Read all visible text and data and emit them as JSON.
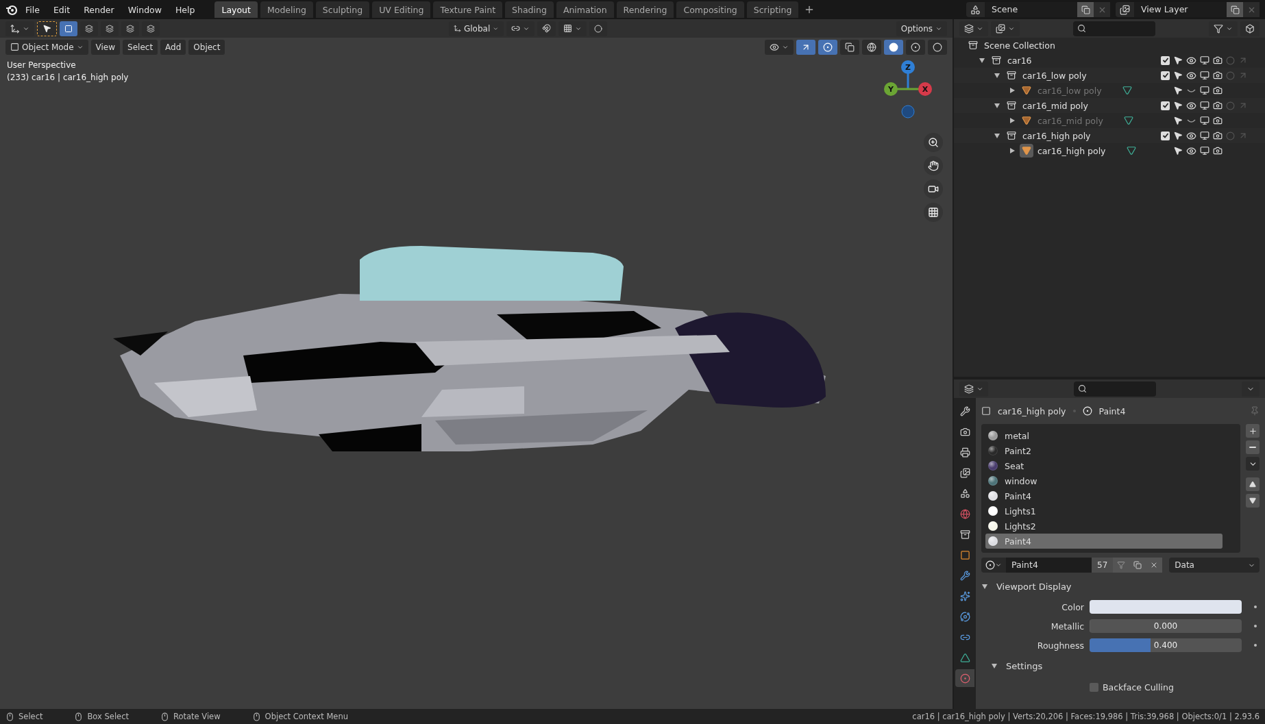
{
  "menu": [
    "File",
    "Edit",
    "Render",
    "Window",
    "Help"
  ],
  "workspaces": [
    {
      "label": "Layout",
      "selected": true
    },
    {
      "label": "Modeling",
      "selected": false
    },
    {
      "label": "Sculpting",
      "selected": false
    },
    {
      "label": "UV Editing",
      "selected": false
    },
    {
      "label": "Texture Paint",
      "selected": false
    },
    {
      "label": "Shading",
      "selected": false
    },
    {
      "label": "Animation",
      "selected": false
    },
    {
      "label": "Rendering",
      "selected": false
    },
    {
      "label": "Compositing",
      "selected": false
    },
    {
      "label": "Scripting",
      "selected": false
    }
  ],
  "scene": {
    "name": "Scene"
  },
  "view_layer": {
    "name": "View Layer"
  },
  "tool_header": {
    "orientation": "Global",
    "options": "Options"
  },
  "viewport_header": {
    "mode": "Object Mode",
    "menus": [
      "View",
      "Select",
      "Add",
      "Object"
    ]
  },
  "viewport": {
    "overlay_lines": [
      "User Perspective",
      "(233) car16 | car16_high poly"
    ],
    "gizmo_axes": [
      {
        "label": "Z",
        "color": "#2f7fd6"
      },
      {
        "label": "Y",
        "color": "#6ba534"
      },
      {
        "label": "X",
        "color": "#d63a4a"
      }
    ],
    "car": {
      "kind": "picture"
    }
  },
  "outliner": {
    "root": "Scene Collection",
    "items": [
      {
        "name": "car16",
        "kind": "collection",
        "expanded": true,
        "checked": true,
        "visible": true,
        "selected": false,
        "children": [
          {
            "name": "car16_low poly",
            "kind": "collection",
            "expanded": true,
            "checked": true,
            "visible": true,
            "selected": false,
            "children": [
              {
                "name": "car16_low poly",
                "kind": "mesh",
                "expanded": false,
                "visible": false,
                "selected": false
              }
            ]
          },
          {
            "name": "car16_mid poly",
            "kind": "collection",
            "expanded": true,
            "checked": true,
            "visible": true,
            "selected": false,
            "children": [
              {
                "name": "car16_mid poly",
                "kind": "mesh",
                "expanded": false,
                "visible": false,
                "selected": false
              }
            ]
          },
          {
            "name": "car16_high poly",
            "kind": "collection",
            "expanded": true,
            "checked": true,
            "visible": true,
            "selected": false,
            "children": [
              {
                "name": "car16_high poly",
                "kind": "mesh",
                "expanded": false,
                "visible": true,
                "selected": true
              }
            ]
          }
        ]
      }
    ]
  },
  "properties": {
    "tabs": [
      {
        "kind": "tool",
        "selected": false
      },
      {
        "kind": "render",
        "selected": false
      },
      {
        "kind": "output",
        "selected": false
      },
      {
        "kind": "view_layer",
        "selected": false
      },
      {
        "kind": "scene",
        "selected": false
      },
      {
        "kind": "world",
        "selected": false
      },
      {
        "kind": "collection",
        "selected": false
      },
      {
        "kind": "object",
        "selected": false
      },
      {
        "kind": "modifiers",
        "selected": false
      },
      {
        "kind": "particles",
        "selected": false
      },
      {
        "kind": "physics",
        "selected": false
      },
      {
        "kind": "constraints",
        "selected": false
      },
      {
        "kind": "data",
        "selected": false
      },
      {
        "kind": "material",
        "selected": true
      }
    ],
    "object": "car16_high poly",
    "material": "Paint4",
    "slots": [
      {
        "name": "metal",
        "color": "#9a9a9a",
        "selected": false
      },
      {
        "name": "Paint2",
        "color": "#2a2a2a",
        "selected": false
      },
      {
        "name": "Seat",
        "color": "#4a3d6e",
        "selected": false
      },
      {
        "name": "window",
        "color": "#4d7378",
        "selected": false
      },
      {
        "name": "Paint4",
        "color": "#e0e0e4",
        "selected": false
      },
      {
        "name": "Lights1",
        "color": "#ffffff",
        "selected": false
      },
      {
        "name": "Lights2",
        "color": "#f6f6ea",
        "selected": false
      },
      {
        "name": "Paint4",
        "color": "#dcdde2",
        "selected": true
      }
    ],
    "datablock": {
      "name": "Paint4",
      "users": "57",
      "link": "Data"
    },
    "panel": {
      "title": "Viewport Display",
      "expanded": true,
      "fields": [
        {
          "kind": "color",
          "label": "Color",
          "color": "#dfe4ee"
        },
        {
          "kind": "slider",
          "label": "Metallic",
          "reading": "0.000",
          "level": 0
        },
        {
          "kind": "slider",
          "label": "Roughness",
          "reading": "0.400",
          "level": 0.4
        }
      ],
      "subpanel": {
        "title": "Settings",
        "expanded": true,
        "checkbox": {
          "label": "Backface Culling",
          "checked": false
        }
      }
    }
  },
  "status_bar": {
    "hints": [
      "Select",
      "Box Select",
      "Rotate View",
      "Object Context Menu"
    ],
    "stats": "car16 | car16_high poly | Verts:20,206 | Faces:19,986 | Tris:39,968 | Objects:0/1 | 2.93.6"
  }
}
